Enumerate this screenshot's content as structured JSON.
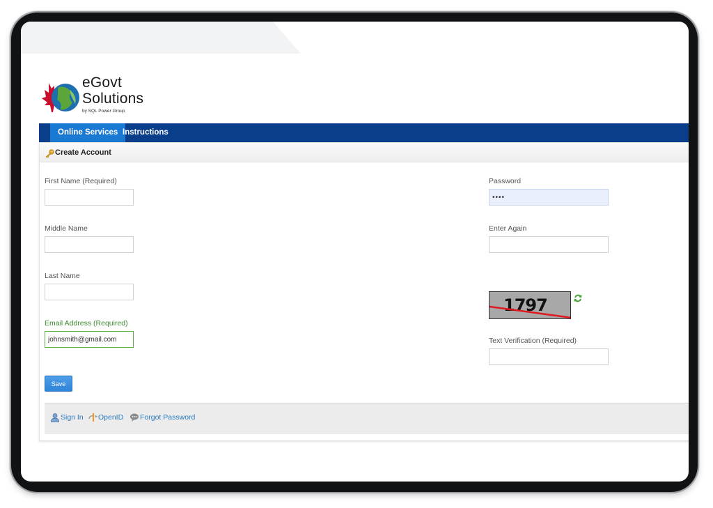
{
  "brand": {
    "name_line1": "eGovt",
    "name_line2": "Solutions",
    "byline": "by SQL Power Group"
  },
  "nav": {
    "tabs": [
      {
        "label": "Online Services",
        "active": true
      },
      {
        "label": "Instructions",
        "active": false
      }
    ]
  },
  "panel": {
    "title": "Create Account",
    "icon": "key-icon"
  },
  "form": {
    "first_name": {
      "label": "First Name (Required)",
      "value": ""
    },
    "middle_name": {
      "label": "Middle Name",
      "value": ""
    },
    "last_name": {
      "label": "Last Name",
      "value": ""
    },
    "email": {
      "label": "Email Address (Required)",
      "value": "johnsmith@gmail.com"
    },
    "password": {
      "label": "Password",
      "value": "••••"
    },
    "password_again": {
      "label": "Enter Again",
      "value": ""
    },
    "captcha": {
      "text": "1797"
    },
    "verification": {
      "label": "Text Verification (Required)",
      "value": ""
    },
    "save_label": "Save"
  },
  "footer": {
    "links": [
      {
        "label": "Sign In",
        "icon": "user-icon"
      },
      {
        "label": "OpenID",
        "icon": "openid-icon"
      },
      {
        "label": "Forgot Password",
        "icon": "speech-bubble-icon"
      }
    ]
  },
  "colors": {
    "nav_bar": "#0a3d8a",
    "nav_active": "#1a79d2",
    "accent_green": "#3c8a2f",
    "link_blue": "#2a7bc0",
    "save_button": "#2e84d8"
  }
}
